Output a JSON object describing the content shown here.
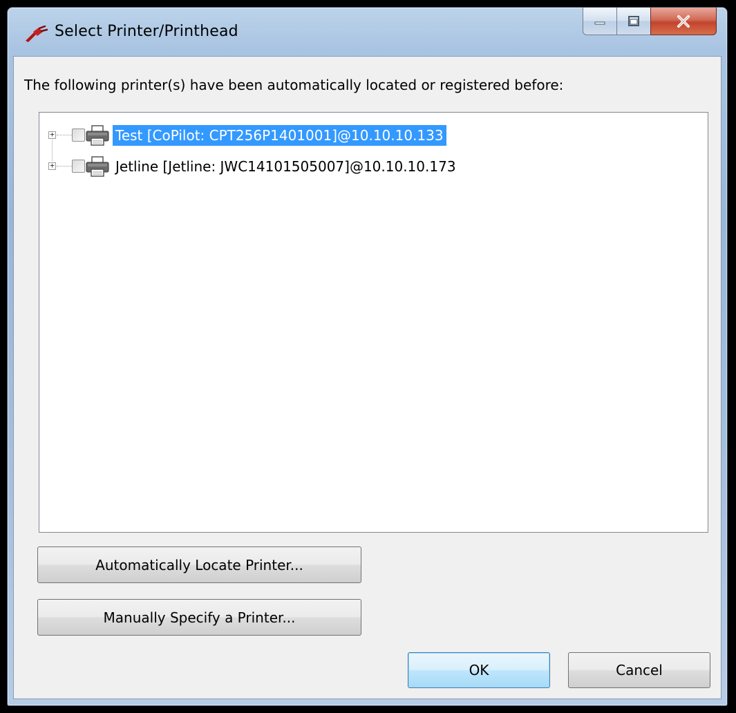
{
  "window": {
    "title": "Select Printer/Printhead",
    "icon": "app-plug-icon"
  },
  "caption_buttons": {
    "minimize_icon": "minimize-icon",
    "maximize_icon": "maximize-icon",
    "close_icon": "close-icon"
  },
  "dialog": {
    "intro_text": "The following printer(s) have been automatically located or registered before:",
    "printers": [
      {
        "label": "Test [CoPilot: CPT256P1401001]@10.10.10.133",
        "selected": true,
        "checked": false,
        "expander": "+",
        "icon": "printer-icon"
      },
      {
        "label": "Jetline [Jetline: JWC14101505007]@10.10.10.173",
        "selected": false,
        "checked": false,
        "expander": "+",
        "icon": "printer-icon"
      }
    ],
    "buttons": {
      "auto_locate": "Automatically Locate Printer...",
      "manual_specify": "Manually Specify a Printer...",
      "ok": "OK",
      "cancel": "Cancel"
    }
  },
  "colors": {
    "selection": "#3399ff",
    "close_button": "#c2442c",
    "dialog_bg": "#f0f0f0"
  }
}
